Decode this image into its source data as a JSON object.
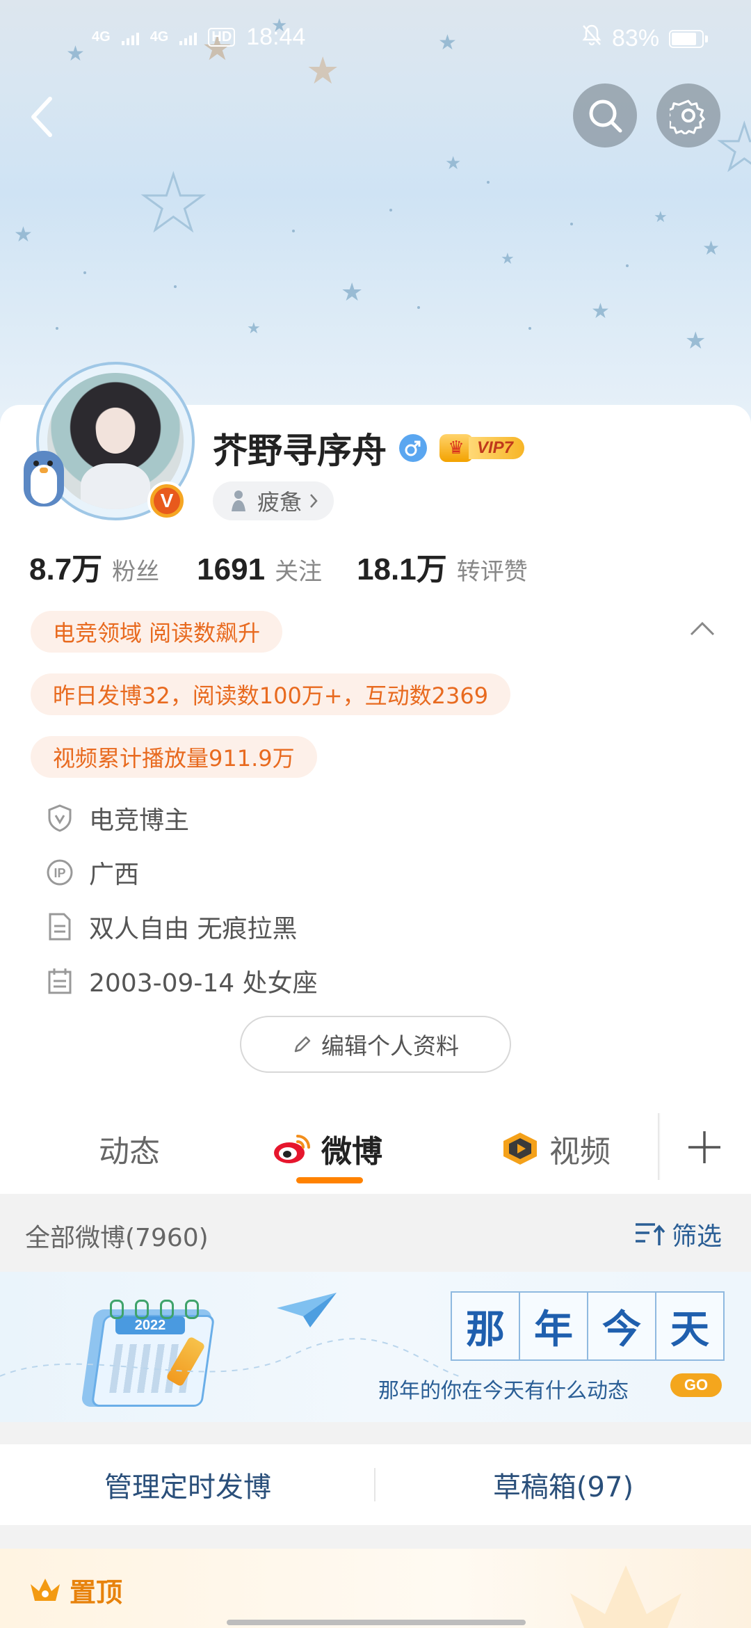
{
  "status_bar": {
    "signal1": "4G",
    "signal2": "4G",
    "hd": "HD",
    "time": "18:44",
    "battery": "83%"
  },
  "header": {
    "back_icon": "chevron-left-icon",
    "search_icon": "search-icon",
    "settings_icon": "gear-icon"
  },
  "profile": {
    "name": "芥野寻序舟",
    "gender_icon": "male-icon",
    "vip_label": "VIP7",
    "mood_label": "疲惫",
    "verified_badge": "V"
  },
  "stats": [
    {
      "value": "8.7万",
      "label": "粉丝"
    },
    {
      "value": "1691",
      "label": "关注"
    },
    {
      "value": "18.1万",
      "label": "转评赞"
    }
  ],
  "tags": [
    "电竞领域 阅读数飙升",
    "昨日发博32，阅读数100万+，互动数2369",
    "视频累计播放量911.9万"
  ],
  "info": [
    {
      "icon": "shield-v-icon",
      "text": "电竞博主"
    },
    {
      "icon": "ip-icon",
      "text": "广西"
    },
    {
      "icon": "document-icon",
      "text": "双人自由 无痕拉黑"
    },
    {
      "icon": "calendar-icon",
      "text": "2003-09-14 处女座"
    }
  ],
  "edit_button": "编辑个人资料",
  "tabs": [
    {
      "label": "动态"
    },
    {
      "label": "微博",
      "icon": "weibo-icon",
      "active": true
    },
    {
      "label": "视频",
      "icon": "video-icon"
    }
  ],
  "add_tab_icon": "plus-icon",
  "weibo_section": {
    "title": "全部微博(7960)",
    "filter_label": "筛选"
  },
  "banner": {
    "chars": [
      "那",
      "年",
      "今",
      "天"
    ],
    "subtitle": "那年的你在今天有什么动态",
    "go": "GO",
    "calendar_year": "2022"
  },
  "actions": {
    "manage": "管理定时发博",
    "drafts": "草稿箱(97)"
  },
  "pinned": {
    "label": "置顶"
  },
  "colors": {
    "accent": "#ff8200",
    "tag_text": "#e86a1f",
    "tag_bg": "#fdf0e9"
  }
}
